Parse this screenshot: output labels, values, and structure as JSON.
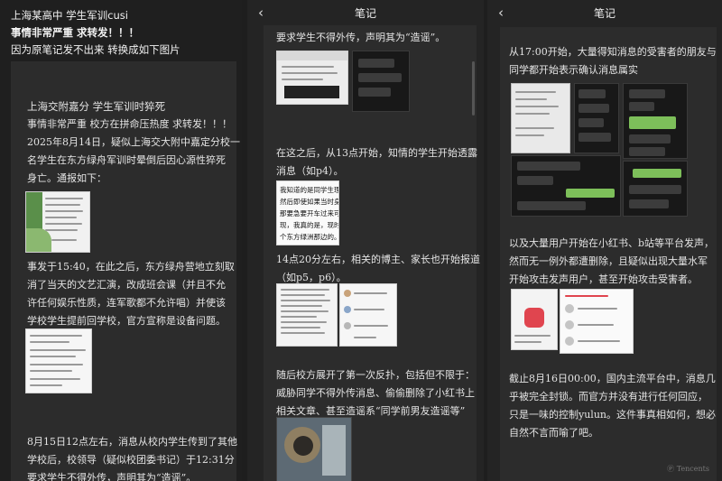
{
  "panel1": {
    "header": [
      "上海某高中 学生军训cusi",
      "事情非常严重 求转发！！！",
      "因为原笔记发不出来 转换成如下图片"
    ],
    "post": [
      "上海交附嘉分 学生军训时猝死",
      "事情非常严重 校方在拼命压热度 求转发！！！",
      "2025年8月14日，疑似上海交大附中嘉定分校一",
      "名学生在东方绿舟军训时晕倒后因心源性猝死",
      "身亡。通报如下：",
      "事发于15:40，在此之后，东方绿舟营地立刻取",
      "消了当天的文艺汇演，改成班会课（并且不允",
      "许任何娱乐性质，连军歌都不允许唱）并使该",
      "学校学生提前回学校，官方宣称是设备问题。",
      "8月15日12点左右，消息从校内学生传到了其他",
      "学校后，校领导（疑似校团委书记）于12:31分",
      "要求学生不得外传，声明其为“造谣”。"
    ]
  },
  "panel2": {
    "title": "笔记",
    "back_icon": "‹",
    "paragraphs": [
      "要求学生不得外传，声明其为“造谣”。",
      "在这之后，从13点开始，知情的学生开始透露",
      "消息（如p4）。",
      "14点20分左右，相关的博主、家长也开始报道",
      "（如p5，p6）。",
      "随后校方展开了第一次反扑，包括但不限于：",
      "威胁同学不得外传消息、偷偷删除了小红书上",
      "相关文章、甚至造谣系“同学前男友造谣等”"
    ],
    "crop_text": [
      "我知道的是同学生理",
      "然后即使如果当时身边",
      "那要急要开车过来可能",
      "现，我真的是，现时",
      "个东方绿洲那边的。"
    ]
  },
  "panel3": {
    "title": "笔记",
    "back_icon": "‹",
    "paragraphs": [
      "从17:00开始，大量得知消息的受害者的朋友与",
      "同学都开始表示确认消息属实",
      "以及大量用户开始在小红书、b站等平台发声，",
      "然而无一例外都遭删除，且疑似出现大量水军",
      "开始攻击发声用户，甚至开始攻击受害者。",
      "截止8月16日00:00，国内主流平台中，消息几",
      "乎被完全封锁。而官方并没有进行任何回应，",
      "只是一味的控制yulun。这件事真相如何，想必",
      "自然不言而喻了吧。"
    ],
    "watermark": "Ⓟ Tencents"
  }
}
